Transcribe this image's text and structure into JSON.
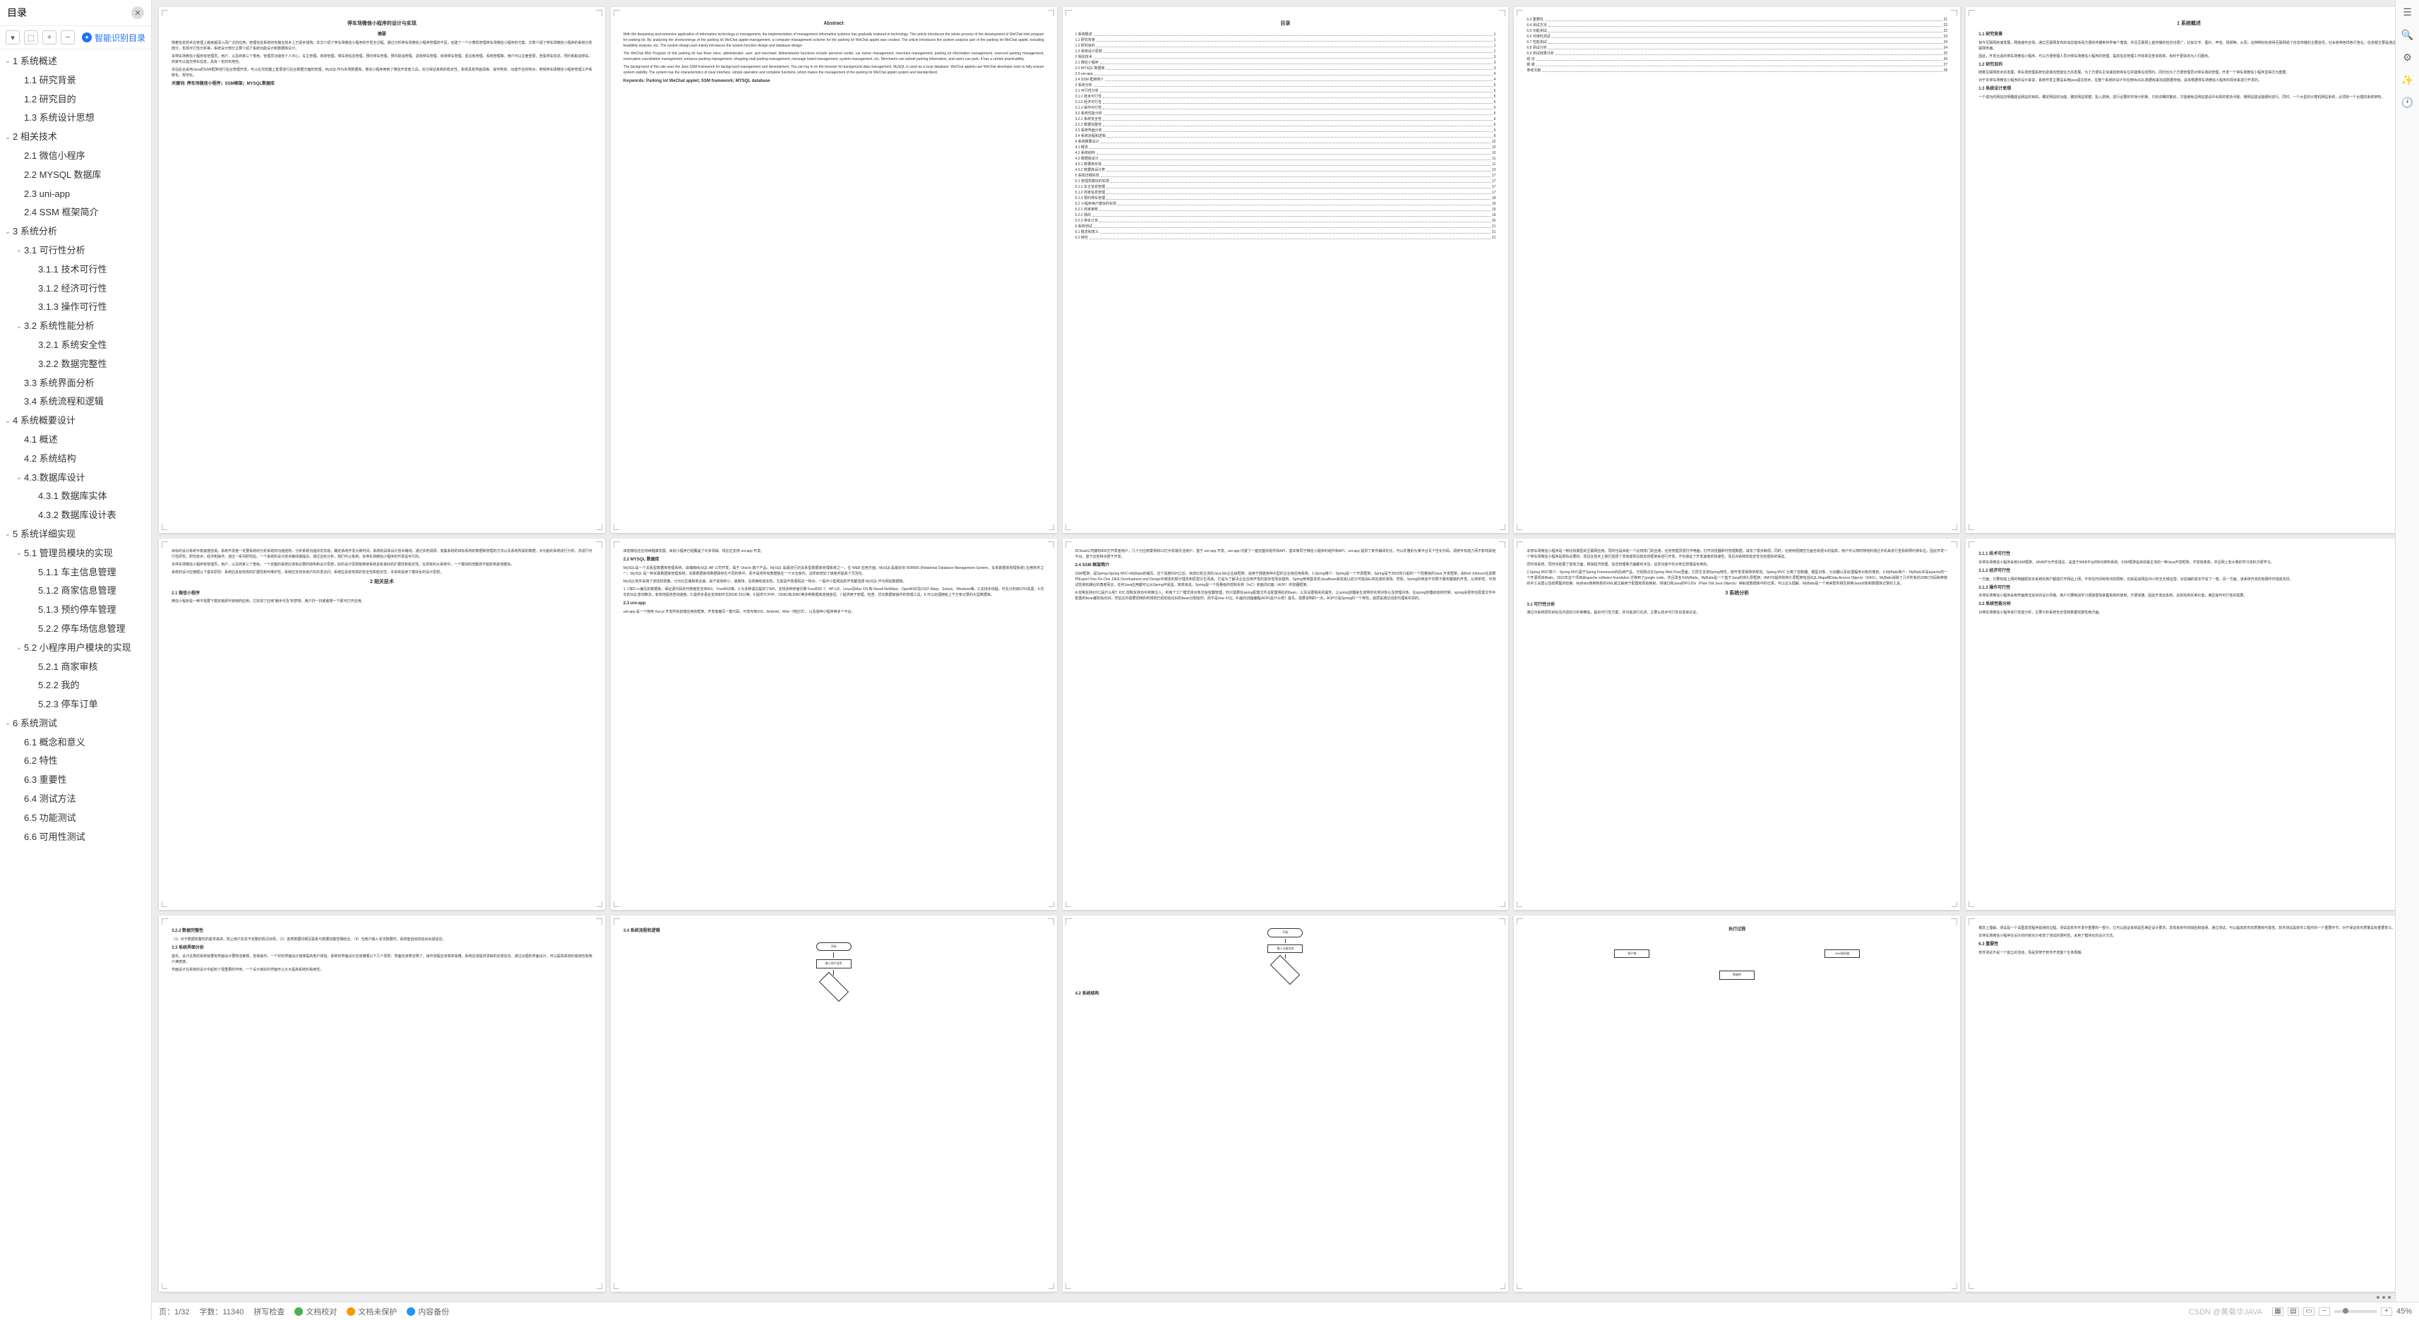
{
  "sidebar": {
    "title": "目录",
    "smart": "智能识别目录",
    "toc": [
      {
        "l": 0,
        "c": true,
        "t": "1 系统概述"
      },
      {
        "l": 1,
        "t": "1.1 研究背景"
      },
      {
        "l": 1,
        "t": "1.2 研究目的"
      },
      {
        "l": 1,
        "t": "1.3 系统设计思想"
      },
      {
        "l": 0,
        "c": true,
        "t": "2 相关技术"
      },
      {
        "l": 1,
        "t": "2.1 微信小程序"
      },
      {
        "l": 1,
        "t": "2.2 MYSQL 数据库"
      },
      {
        "l": 1,
        "t": "2.3 uni-app"
      },
      {
        "l": 1,
        "t": "2.4 SSM 框架简介"
      },
      {
        "l": 0,
        "c": true,
        "t": "3 系统分析"
      },
      {
        "l": 1,
        "c": true,
        "t": "3.1 可行性分析"
      },
      {
        "l": 2,
        "t": "3.1.1 技术可行性"
      },
      {
        "l": 2,
        "t": "3.1.2 经济可行性"
      },
      {
        "l": 2,
        "t": "3.1.3 操作可行性"
      },
      {
        "l": 1,
        "c": true,
        "t": "3.2 系统性能分析"
      },
      {
        "l": 2,
        "t": "3.2.1 系统安全性"
      },
      {
        "l": 2,
        "t": "3.2.2 数据完整性"
      },
      {
        "l": 1,
        "t": "3.3 系统界面分析"
      },
      {
        "l": 1,
        "t": "3.4 系统流程和逻辑"
      },
      {
        "l": 0,
        "c": true,
        "t": "4 系统概要设计"
      },
      {
        "l": 1,
        "t": "4.1 概述"
      },
      {
        "l": 1,
        "t": "4.2 系统结构"
      },
      {
        "l": 1,
        "c": true,
        "t": "4.3.数据库设计"
      },
      {
        "l": 2,
        "t": "4.3.1 数据库实体"
      },
      {
        "l": 2,
        "t": "4.3.2 数据库设计表"
      },
      {
        "l": 0,
        "c": true,
        "t": "5 系统详细实现"
      },
      {
        "l": 1,
        "c": true,
        "t": "5.1 管理员模块的实现"
      },
      {
        "l": 2,
        "t": "5.1.1 车主信息管理"
      },
      {
        "l": 2,
        "t": "5.1.2 商家信息管理"
      },
      {
        "l": 2,
        "t": "5.1.3 预约停车管理"
      },
      {
        "l": 2,
        "t": "5.2.2 停车场信息管理"
      },
      {
        "l": 1,
        "c": true,
        "t": "5.2 小程序用户模块的实现"
      },
      {
        "l": 2,
        "t": "5.2.1 商家审核"
      },
      {
        "l": 2,
        "t": "5.2.2 我的"
      },
      {
        "l": 2,
        "t": "5.2.3 停车订单"
      },
      {
        "l": 0,
        "c": true,
        "t": "6 系统测试"
      },
      {
        "l": 1,
        "t": "6.1 概念和意义"
      },
      {
        "l": 1,
        "t": "6.2 特性"
      },
      {
        "l": 1,
        "t": "6.3 重要性"
      },
      {
        "l": 1,
        "t": "6.4 测试方法"
      },
      {
        "l": 1,
        "t": "6.5 功能测试"
      },
      {
        "l": 1,
        "t": "6.6 可用性测试"
      }
    ]
  },
  "pages": {
    "p1": {
      "title": "停车场微信小程序的设计与实现",
      "sub": "摘要",
      "kw": "关键词: 停车场微信小程序；SSM框架；MYSQL数据库"
    },
    "p2": {
      "title": "Abstract",
      "kw": "Keywords: Parking lot WeChat applet; SSM framework; MYSQL database"
    },
    "p3": {
      "title": "目录",
      "lines": [
        [
          "1 系统概述",
          "1"
        ],
        [
          "1.1 研究背景",
          "1"
        ],
        [
          "1.2 研究目的",
          "1"
        ],
        [
          "1.3 系统设计思想",
          "1"
        ],
        [
          "2 相关技术",
          "3"
        ],
        [
          "2.1 微信小程序",
          "3"
        ],
        [
          "2.2 MYSQL 数据库",
          "3"
        ],
        [
          "2.3 uni-app",
          "4"
        ],
        [
          "2.4 SSM 框架简介",
          "4"
        ],
        [
          "3 系统分析",
          "5"
        ],
        [
          "3.1 可行性分析",
          "5"
        ],
        [
          "3.1.1 技术可行性",
          "5"
        ],
        [
          "3.1.2 经济可行性",
          "5"
        ],
        [
          "3.1.3 操作可行性",
          "5"
        ],
        [
          "3.2 系统性能分析",
          "6"
        ],
        [
          "3.2.1 系统安全性",
          "6"
        ],
        [
          "3.2.2 数据完整性",
          "6"
        ],
        [
          "3.3 系统界面分析",
          "6"
        ],
        [
          "3.4 系统流程和逻辑",
          "8"
        ],
        [
          "4 系统概要设计",
          "10"
        ],
        [
          "4.1 概述",
          "10"
        ],
        [
          "4.2 系统结构",
          "10"
        ],
        [
          "4.3 数据库设计",
          "11"
        ],
        [
          "4.3.1 数据库实体",
          "11"
        ],
        [
          "4.3.2 数据库设计表",
          "13"
        ],
        [
          "5 系统详细实现",
          "17"
        ],
        [
          "5.1 管理员模块的实现",
          "17"
        ],
        [
          "5.1.1 车主信息管理",
          "17"
        ],
        [
          "5.1.2 商家信息管理",
          "17"
        ],
        [
          "5.1.3 预约停车管理",
          "18"
        ],
        [
          "5.2 小程序用户模块的实现",
          "19"
        ],
        [
          "5.2.1 商家审核",
          "19"
        ],
        [
          "5.2.2 我的",
          "19"
        ],
        [
          "5.2.3 停车订单",
          "20"
        ],
        [
          "6 系统测试",
          "21"
        ],
        [
          "6.1 概念和意义",
          "21"
        ],
        [
          "6.2 特性",
          "21"
        ]
      ]
    },
    "p4": {
      "lines": [
        [
          "6.3 重要性",
          "21"
        ],
        [
          "6.4 测试方法",
          "22"
        ],
        [
          "6.5 功能测试",
          "22"
        ],
        [
          "6.6 可用性测试",
          "23"
        ],
        [
          "6.7 性能测试",
          "24"
        ],
        [
          "6.8 测试分析",
          "24"
        ],
        [
          "6.9 测试结果分析",
          "25"
        ],
        [
          "结 论",
          "26"
        ],
        [
          "致 谢",
          "27"
        ],
        [
          "参考文献",
          "28"
        ]
      ]
    },
    "p5": {
      "h": "1 系统概述",
      "s1": "1.1 研究背景",
      "s2": "1.2 研究目的",
      "s3": "1.3 系统设计思想"
    },
    "p6": {
      "h": "2 相关技术",
      "s1": "2.1 微信小程序"
    },
    "p7": {
      "s1": "2.2 MYSQL 数据库",
      "s2": "2.3 uni-app"
    },
    "p8": {
      "s1": "2.4 SSM 框架简介"
    },
    "p9": {
      "h": "3 系统分析",
      "s1": "3.1 可行性分析"
    },
    "p10": {
      "s1": "3.1.1 技术可行性",
      "s2": "3.1.2 经济可行性",
      "s3": "3.1.3 操作可行性",
      "s4": "3.2 系统性能分析"
    },
    "p11": {
      "s1": "3.2.2 数据完整性",
      "s2": "3.3 系统界面分析"
    },
    "p12": {
      "s1": "3.4 系统流程和逻辑",
      "f1": "开始",
      "f2": "输入用户信息"
    },
    "p13": {
      "f1": "开始",
      "f2": "输入注册信息",
      "s1": "4.2 系统结构"
    },
    "p14": {
      "h": "执行过程",
      "b1": "客户端",
      "b2": "Web服务器",
      "b3": "数据库"
    },
    "p15": {
      "s1": "6.3 重要性"
    }
  },
  "status": {
    "page": "页：1/32",
    "words": "字数：11340",
    "check": "拼写检查",
    "proof": "文档校对",
    "backup": "文档未保护",
    "cloud": "内容备份",
    "zoom": "45%",
    "watermark": "CSDN @黄菊华JAVA"
  }
}
